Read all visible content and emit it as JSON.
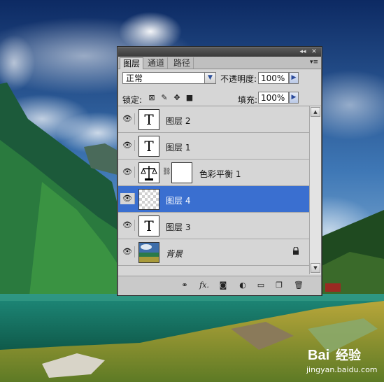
{
  "panel": {
    "tabs": [
      "图层",
      "通道",
      "路径"
    ],
    "collapse_icon": "double-left-arrow-icon",
    "close_icon": "close-icon",
    "menu_icon": "panel-menu-icon"
  },
  "controls": {
    "blend_mode": "正常",
    "opacity_label": "不透明度:",
    "opacity_value": "100%",
    "lock_label": "锁定:",
    "fill_label": "填充:",
    "fill_value": "100%"
  },
  "layers": [
    {
      "name": "图层 2",
      "type": "text",
      "thumb": "T",
      "visible": true,
      "selected": false
    },
    {
      "name": "图层 1",
      "type": "text",
      "thumb": "T",
      "visible": true,
      "selected": false
    },
    {
      "name": "色彩平衡 1",
      "type": "adjustment",
      "visible": true,
      "selected": false
    },
    {
      "name": "图层 4",
      "type": "pixel",
      "visible": true,
      "selected": true
    },
    {
      "name": "图层 3",
      "type": "text",
      "thumb": "T",
      "visible": true,
      "selected": false
    },
    {
      "name": "背景",
      "type": "background",
      "visible": true,
      "selected": false,
      "locked": true
    }
  ],
  "footer_icons": [
    "link-layers-icon",
    "fx-icon",
    "layer-mask-icon",
    "adjustment-layer-icon",
    "new-group-icon",
    "new-layer-icon",
    "trash-icon"
  ],
  "footer_fx_label": "fx.",
  "watermark": {
    "brand": "Bai",
    "brand_suffix": "经验",
    "url": "jingyan.baidu.com"
  },
  "colors": {
    "selection": "#3a6fd0",
    "panel_bg": "#d6d6d6"
  }
}
